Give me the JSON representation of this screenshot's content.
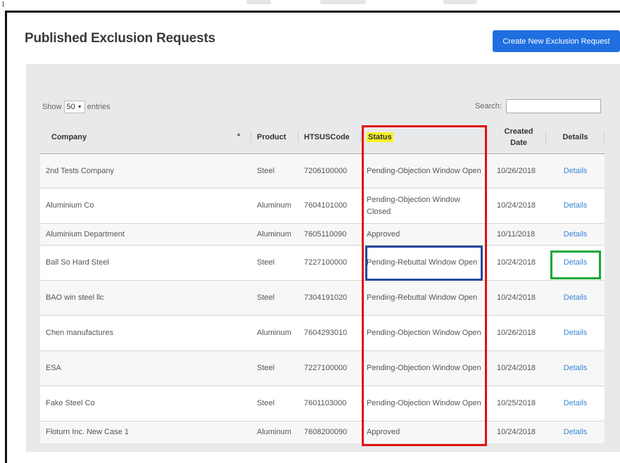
{
  "page": {
    "title": "Published Exclusion Requests",
    "create_button": "Create New Exclusion Request"
  },
  "controls": {
    "show_label": "Show",
    "entries_value": "50",
    "entries_label": "entries",
    "search_label": "Search:",
    "search_value": ""
  },
  "table": {
    "headers": {
      "company": "Company",
      "product": "Product",
      "htsus": "HTSUSCode",
      "status": "Status",
      "created": "Created Date",
      "details": "Details"
    },
    "rows": [
      {
        "company": "2nd Tests Company",
        "product": "Steel",
        "htsus": "7206100000",
        "status": "Pending-Objection Window Open",
        "created": "10/26/2018",
        "details": "Details"
      },
      {
        "company": "Aluminium Co",
        "product": "Aluminum",
        "htsus": "7604101000",
        "status": "Pending-Objection Window Closed",
        "created": "10/24/2018",
        "details": "Details"
      },
      {
        "company": "Aluminium Department",
        "product": "Aluminum",
        "htsus": "7605110090",
        "status": "Approved",
        "created": "10/11/2018",
        "details": "Details"
      },
      {
        "company": "Ball So Hard Steel",
        "product": "Steel",
        "htsus": "7227100000",
        "status": "Pending-Rebuttal Window Open",
        "created": "10/24/2018",
        "details": "Details"
      },
      {
        "company": "BAO win steel llc",
        "product": "Steel",
        "htsus": "7304191020",
        "status": "Pending-Rebuttal Window Open",
        "created": "10/24/2018",
        "details": "Details"
      },
      {
        "company": "Chen manufactures",
        "product": "Aluminum",
        "htsus": "7604293010",
        "status": "Pending-Objection Window Open",
        "created": "10/26/2018",
        "details": "Details"
      },
      {
        "company": "ESA",
        "product": "Steel",
        "htsus": "7227100000",
        "status": "Pending-Objection Window Open",
        "created": "10/24/2018",
        "details": "Details"
      },
      {
        "company": "Fake Steel Co",
        "product": "Steel",
        "htsus": "7601103000",
        "status": "Pending-Objection Window Open",
        "created": "10/25/2018",
        "details": "Details"
      },
      {
        "company": "Floturn Inc. New Case 1",
        "product": "Aluminum",
        "htsus": "7608200090",
        "status": "Approved",
        "created": "10/24/2018",
        "details": "Details"
      }
    ]
  },
  "annotations": {
    "status_column_box_color": "#e01010",
    "status_cell_box_color": "#23479c",
    "details_link_box_color": "#13a835",
    "status_header_highlight": "#f7f222"
  },
  "icons": {
    "sort": "sort-ascending-icon",
    "dropdown": "caret-down-icon"
  }
}
